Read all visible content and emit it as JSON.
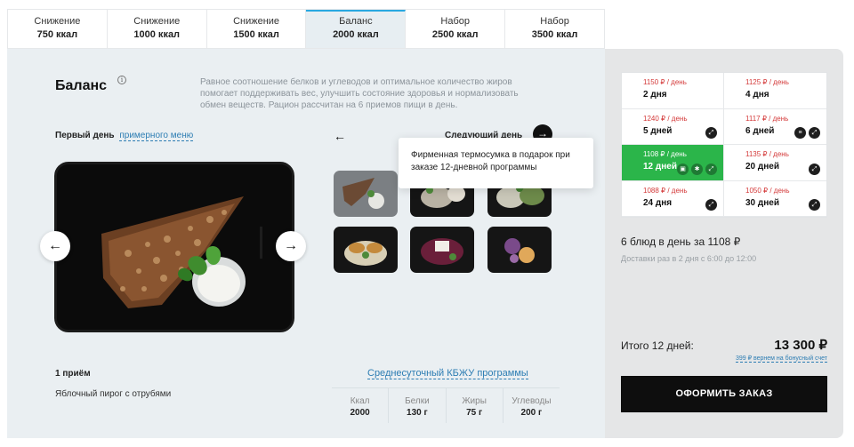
{
  "tabs": [
    {
      "line1": "Снижение",
      "line2": "750 ккал"
    },
    {
      "line1": "Снижение",
      "line2": "1000 ккал"
    },
    {
      "line1": "Снижение",
      "line2": "1500 ккал"
    },
    {
      "line1": "Баланс",
      "line2": "2000 ккал"
    },
    {
      "line1": "Набор",
      "line2": "2500 ккал"
    },
    {
      "line1": "Набор",
      "line2": "3500 ккал"
    }
  ],
  "active_tab": 3,
  "program": {
    "title": "Баланс",
    "info_symbol": "i",
    "description": "Равное соотношение белков и углеводов и оптимальное количество жиров помогает поддерживать вес, улучшить состояние здоровья и нормализовать обмен веществ. Рацион рассчитан на 6 приемов пищи в день."
  },
  "menu": {
    "first_day_label": "Первый день",
    "sample_menu_link": "примерного меню",
    "prev_arrow": "←",
    "next_arrow": "→",
    "next_day_label": "Следующий день",
    "photo_prev": "←",
    "photo_next": "→",
    "meal_number": "1 приём",
    "meal_name": "Яблочный пирог с отрубями",
    "tooltip": "Фирменная термосумка в подарок при заказе 12-дневной программы"
  },
  "kbju": {
    "link": "Среднесуточный КБЖУ программы",
    "items": [
      {
        "label": "Ккал",
        "value": "2000"
      },
      {
        "label": "Белки",
        "value": "130 г"
      },
      {
        "label": "Жиры",
        "value": "75 г"
      },
      {
        "label": "Углеводы",
        "value": "200 г"
      }
    ]
  },
  "options": [
    {
      "price": "1150 ₽ / день",
      "days": "2 дня",
      "icons": []
    },
    {
      "price": "1125 ₽ / день",
      "days": "4 дня",
      "icons": []
    },
    {
      "price": "1240 ₽ / день",
      "days": "5 дней",
      "icons": [
        "expand-icon"
      ]
    },
    {
      "price": "1117 ₽ / день",
      "days": "6 дней",
      "icons": [
        "burger-icon",
        "expand-icon"
      ]
    },
    {
      "price": "1108 ₽ / день",
      "days": "12 дней",
      "icons": [
        "bag-icon",
        "snowflake-icon",
        "expand-icon"
      ]
    },
    {
      "price": "1135 ₽ / день",
      "days": "20 дней",
      "icons": [
        "expand-icon"
      ]
    },
    {
      "price": "1088 ₽ / день",
      "days": "24 дня",
      "icons": [
        "expand-icon"
      ]
    },
    {
      "price": "1050 ₽ / день",
      "days": "30 дней",
      "icons": [
        "expand-icon"
      ]
    }
  ],
  "selected_option": 4,
  "order": {
    "per_day": "6 блюд в день за 1108 ₽",
    "delivery": "Доставки раз в 2 дня с 6:00 до 12:00",
    "total_label": "Итого 12 дней:",
    "total_value": "13 300 ₽",
    "bonus": "399 ₽ вернем на бонусный счет",
    "button": "ОФОРМИТЬ ЗАКАЗ"
  },
  "colors": {
    "accent_blue": "#29a8e0",
    "selected_green": "#2bb54a",
    "price_red": "#d43a3a"
  }
}
